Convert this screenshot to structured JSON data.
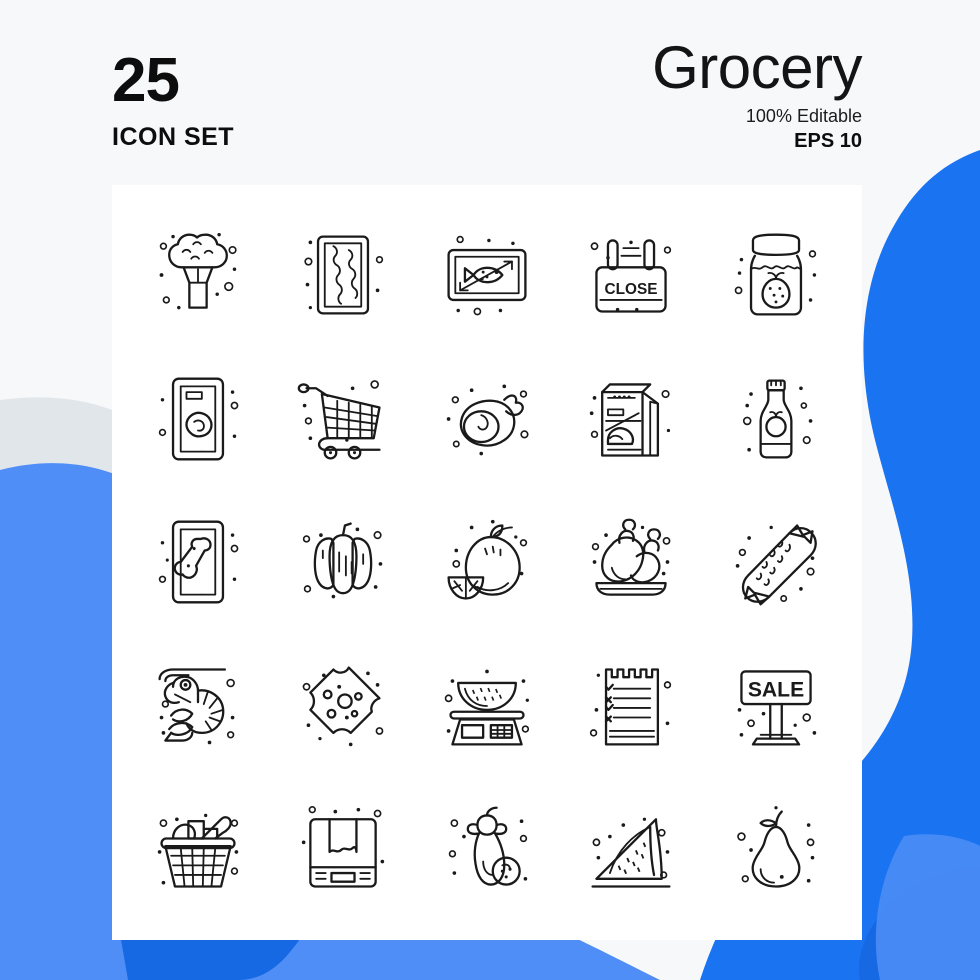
{
  "header": {
    "count": "25",
    "set_label": "ICON SET",
    "brand_title": "Grocery",
    "editable_note": "100% Editable",
    "format_note": "EPS 10"
  },
  "theme": {
    "page_background": "#f7f8fa",
    "card_background": "#ffffff",
    "blue_primary": "#1a73f0",
    "blue_light": "#4f8ef7",
    "blue_dark": "#1668e3",
    "gray_blob": "#e1e6ea",
    "stroke": "#1a1a1a"
  },
  "grid": {
    "columns": 5,
    "rows": 5,
    "total": 25,
    "icons": [
      {
        "id": "broccoli-icon",
        "label": "Broccoli"
      },
      {
        "id": "meat-tray-package-icon",
        "label": "Sausage Tray Package"
      },
      {
        "id": "fish-package-icon",
        "label": "Packaged Fish"
      },
      {
        "id": "close-sign-icon",
        "label": "Close Sign",
        "text": "CLOSE"
      },
      {
        "id": "jam-jar-icon",
        "label": "Strawberry Jam Jar"
      },
      {
        "id": "steak-package-icon",
        "label": "Packaged Steak"
      },
      {
        "id": "shopping-cart-icon",
        "label": "Shopping Cart"
      },
      {
        "id": "ham-leg-icon",
        "label": "Ham Leg"
      },
      {
        "id": "grocery-bag-icon",
        "label": "Grocery Paper Bag"
      },
      {
        "id": "ketchup-bottle-icon",
        "label": "Tomato Sauce Bottle"
      },
      {
        "id": "bone-package-icon",
        "label": "Packaged Bone"
      },
      {
        "id": "bell-pepper-icon",
        "label": "Bell Pepper"
      },
      {
        "id": "orange-fruit-icon",
        "label": "Orange With Slice"
      },
      {
        "id": "roast-chicken-icon",
        "label": "Roast Chicken Platter"
      },
      {
        "id": "candy-icon",
        "label": "Wrapped Candy"
      },
      {
        "id": "shrimp-icon",
        "label": "Shrimp"
      },
      {
        "id": "cheese-icon",
        "label": "Cheese Slice"
      },
      {
        "id": "weighing-scale-icon",
        "label": "Weighing Scale With Watermelon"
      },
      {
        "id": "shopping-list-icon",
        "label": "Shopping Checklist"
      },
      {
        "id": "sale-sign-icon",
        "label": "Sale Signboard",
        "text": "SALE"
      },
      {
        "id": "shopping-basket-icon",
        "label": "Shopping Basket"
      },
      {
        "id": "delivery-box-icon",
        "label": "Cardboard Delivery Box"
      },
      {
        "id": "eggplant-icon",
        "label": "Eggplant And Berry"
      },
      {
        "id": "watermelon-slice-icon",
        "label": "Watermelon Slice"
      },
      {
        "id": "pear-icon",
        "label": "Pear"
      }
    ]
  }
}
